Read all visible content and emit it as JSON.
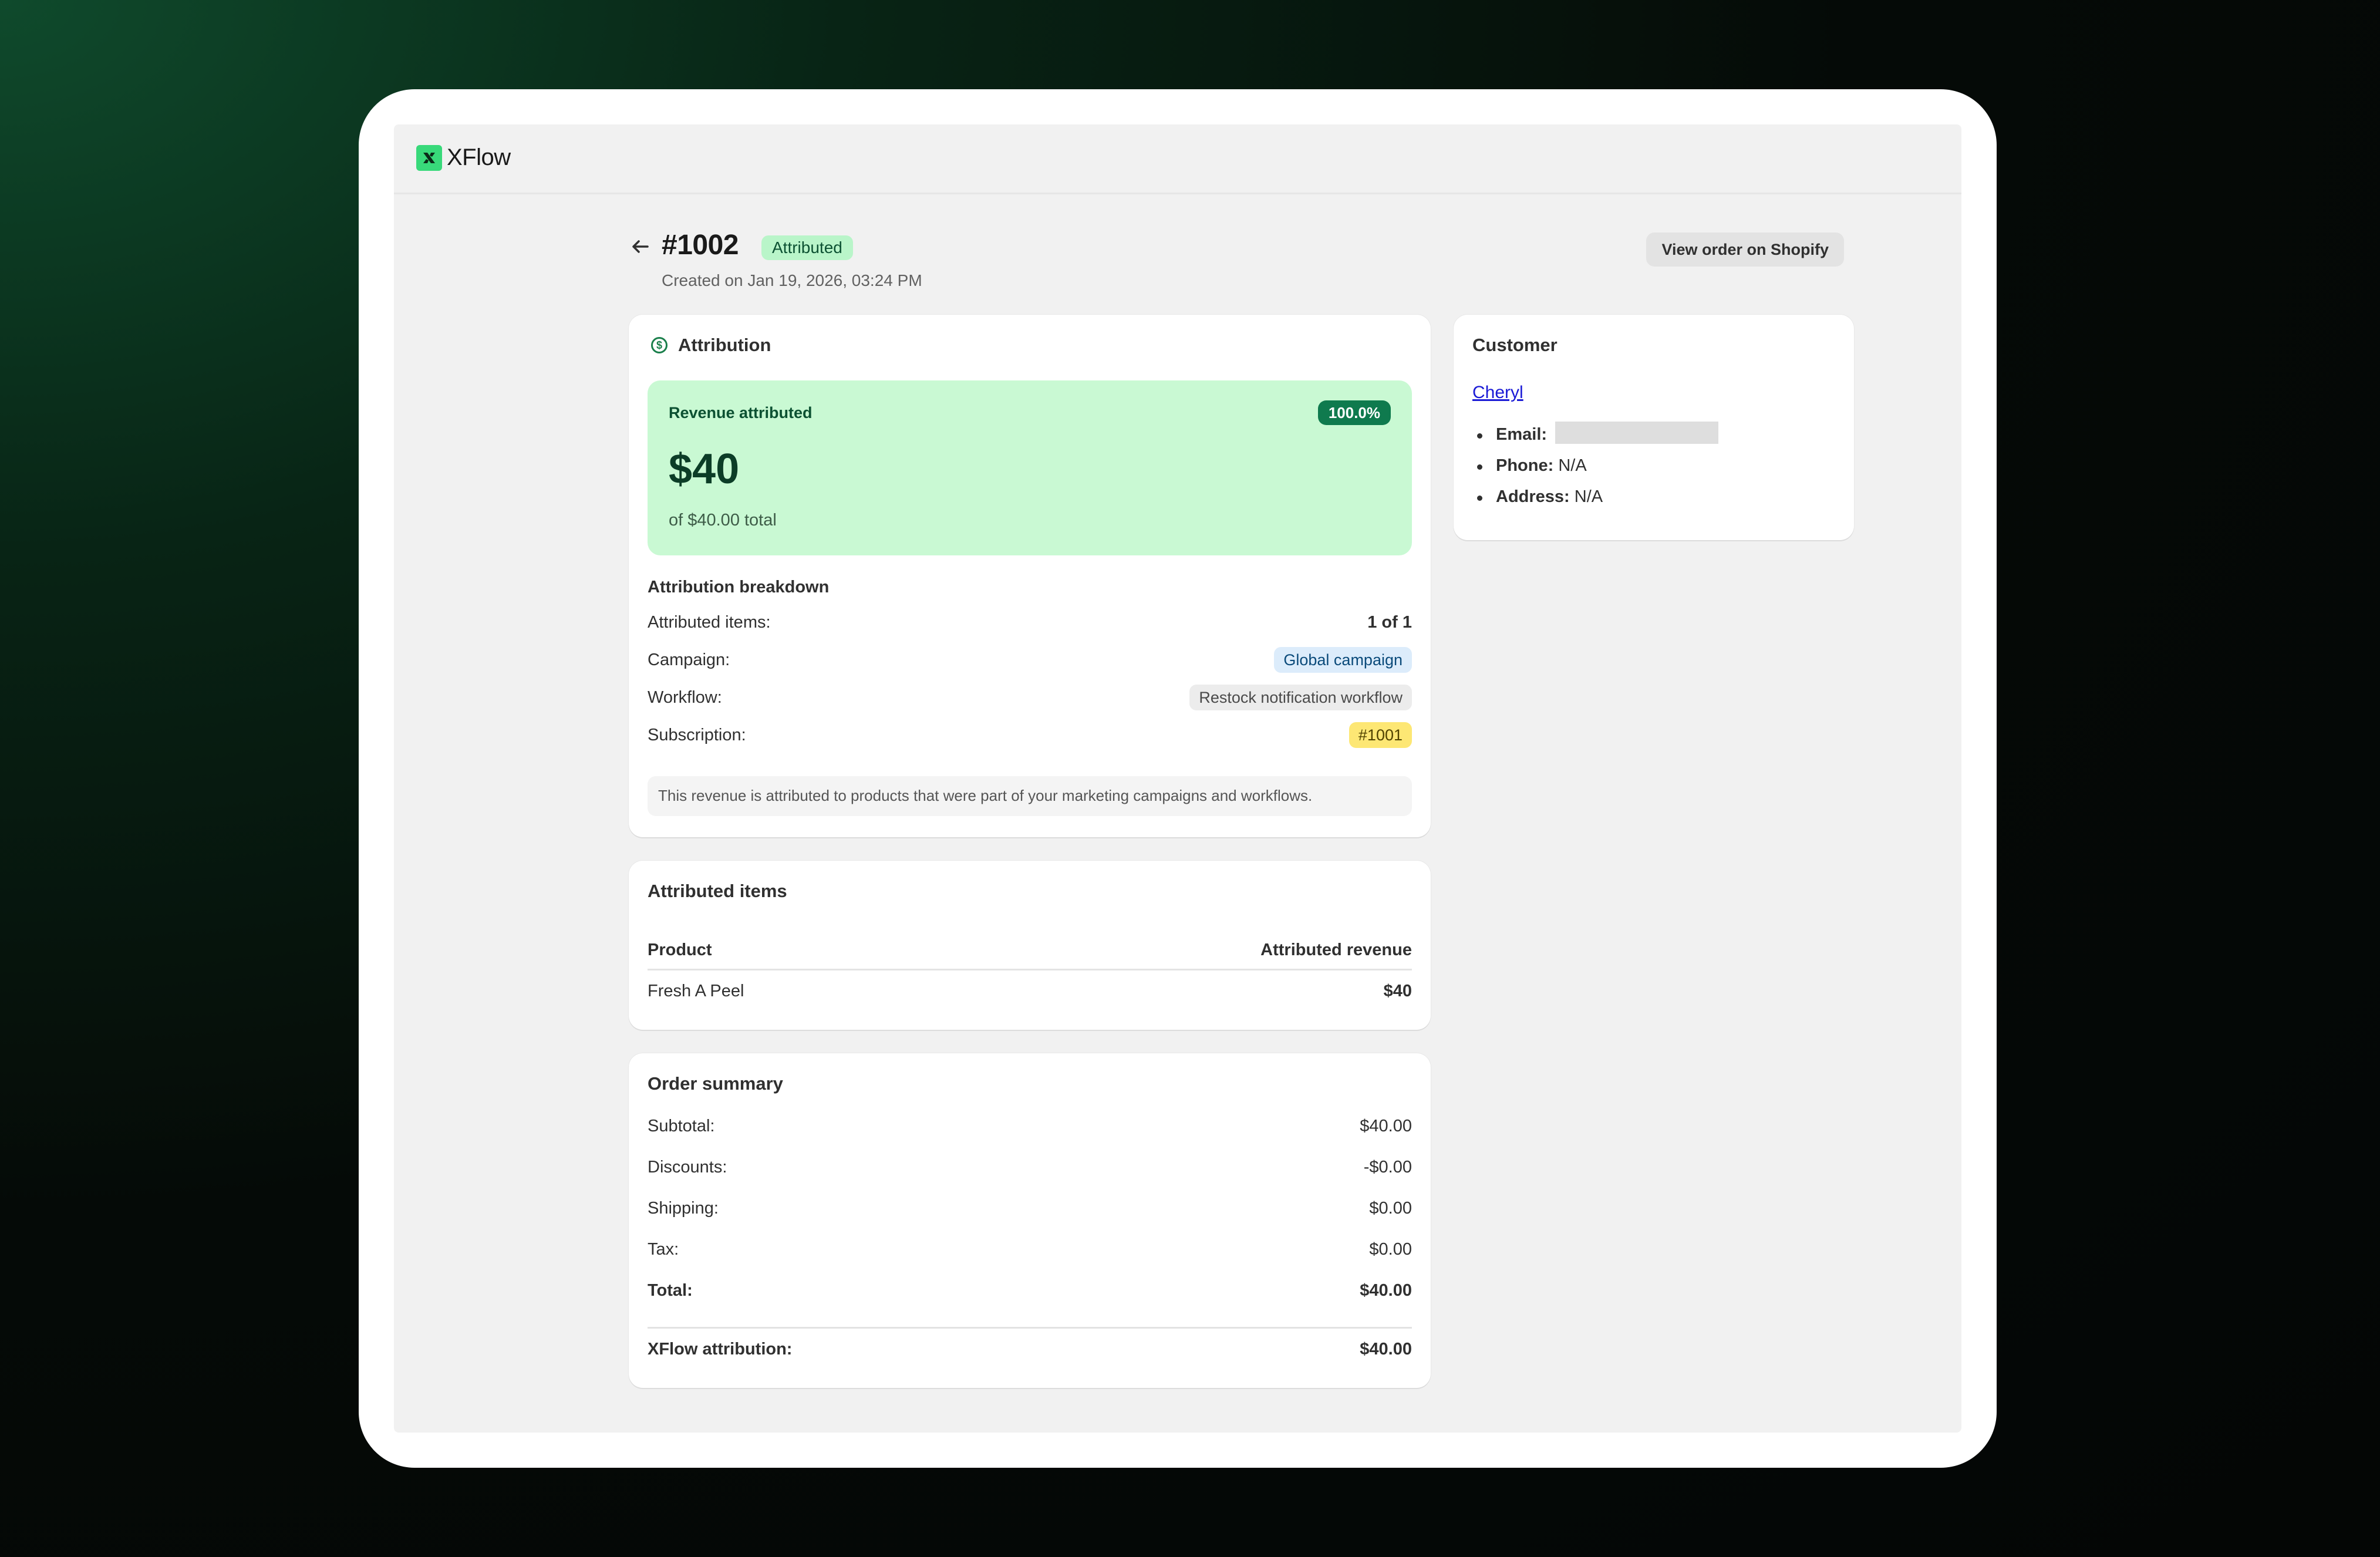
{
  "app": {
    "name": "XFlow"
  },
  "header": {
    "order_id": "#1002",
    "status_badge": "Attributed",
    "created": "Created on Jan 19, 2026, 03:24 PM",
    "shopify_button": "View order on Shopify"
  },
  "attribution": {
    "title": "Attribution",
    "revenue_label": "Revenue attributed",
    "revenue_pct": "100.0%",
    "revenue_amount": "$40",
    "revenue_total": "of $40.00 total",
    "breakdown_title": "Attribution breakdown",
    "rows": [
      {
        "label": "Attributed items:",
        "value": "1 of 1"
      },
      {
        "label": "Campaign:",
        "value": "Global campaign"
      },
      {
        "label": "Workflow:",
        "value": "Restock notification workflow"
      },
      {
        "label": "Subscription:",
        "value": "#1001"
      }
    ],
    "note": "This revenue is attributed to products that were part of your marketing campaigns and workflows."
  },
  "customer": {
    "title": "Customer",
    "name": "Cheryl",
    "email_label": "Email:",
    "email_value": "",
    "phone_label": "Phone:",
    "phone_value": "N/A",
    "address_label": "Address:",
    "address_value": "N/A"
  },
  "attributed_items": {
    "title": "Attributed items",
    "columns": [
      "Product",
      "Attributed revenue"
    ],
    "rows": [
      {
        "product": "Fresh A Peel",
        "revenue": "$40"
      }
    ]
  },
  "order_summary": {
    "title": "Order summary",
    "rows": [
      {
        "label": "Subtotal:",
        "value": "$40.00"
      },
      {
        "label": "Discounts:",
        "value": "-$0.00"
      },
      {
        "label": "Shipping:",
        "value": "$0.00"
      },
      {
        "label": "Tax:",
        "value": "$0.00"
      },
      {
        "label": "Total:",
        "value": "$40.00"
      }
    ],
    "xflow_label": "XFlow attribution:",
    "xflow_value": "$40.00"
  },
  "colors": {
    "accent_green": "#38d97a",
    "attributed_badge_bg": "#b9f5c9",
    "revenue_box_bg": "#c9f9d3",
    "pct_badge_bg": "#0f7a4e",
    "campaign_pill_bg": "#dcecfb",
    "subscription_pill_bg": "#fde774"
  }
}
